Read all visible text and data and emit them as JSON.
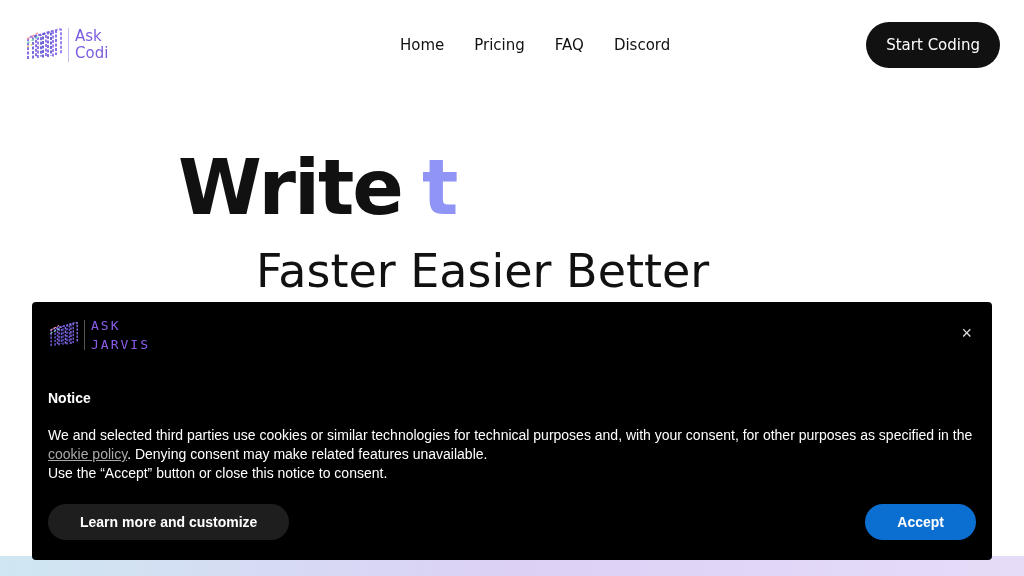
{
  "header": {
    "logo_lines": [
      "Ask",
      "Codi"
    ],
    "nav": [
      {
        "label": "Home"
      },
      {
        "label": "Pricing"
      },
      {
        "label": "FAQ"
      },
      {
        "label": "Discord"
      }
    ],
    "cta": "Start Coding"
  },
  "hero": {
    "title": "Write",
    "typed": "t",
    "subtitle": "Faster Easier Better"
  },
  "cookie_banner": {
    "logo_lines": [
      "ASK",
      "JARVIS"
    ],
    "close": "×",
    "heading": "Notice",
    "text_before_link": "We and selected third parties use cookies or similar technologies for technical purposes and, with your consent, for other purposes as specified in the",
    "link": "cookie policy",
    "text_after_link": ". Denying consent may make related features unavailable.",
    "second_line": "Use the “Accept” button or close this notice to consent.",
    "buttons": [
      {
        "label": "Learn more and customize",
        "kind": "secondary"
      },
      {
        "label": "Accept",
        "kind": "primary"
      }
    ]
  }
}
